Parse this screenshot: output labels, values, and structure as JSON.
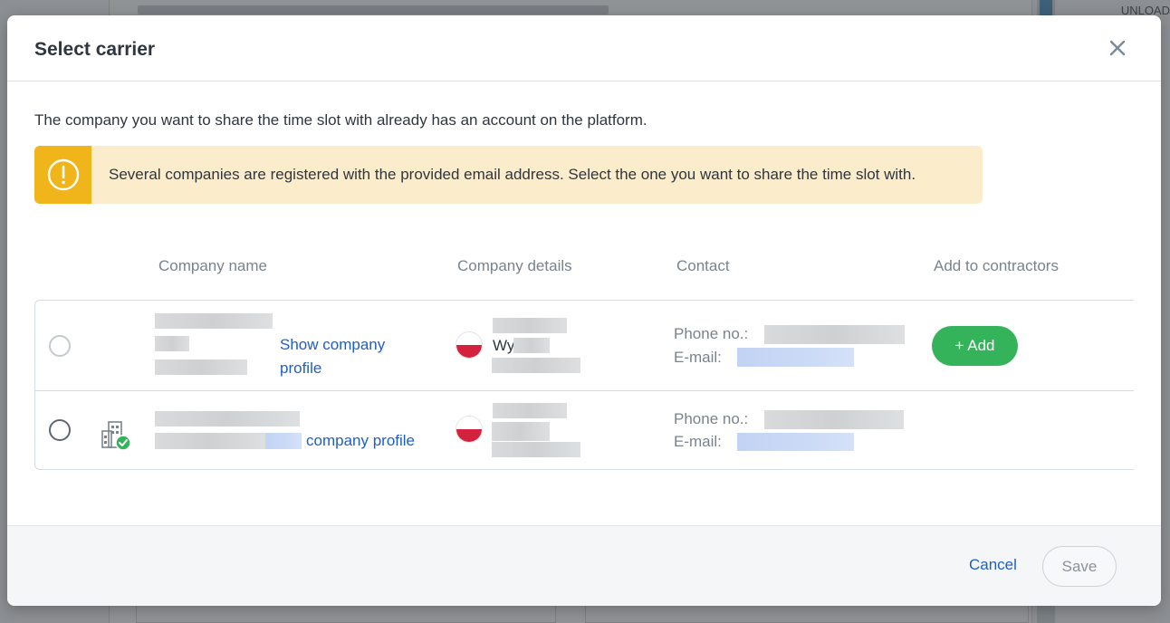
{
  "background": {
    "unload_label": "UNLOAD"
  },
  "modal": {
    "title": "Select carrier",
    "intro": "The company you want to share the time slot with already has an account on the platform.",
    "alert": {
      "text": "Several companies are registered with the provided email address. Select the one you want to share the time slot with.",
      "icon": "exclamation-circle-icon"
    },
    "columns": [
      "Company name",
      "Company details",
      "Contact",
      "Add to contractors"
    ],
    "rows": [
      {
        "selected": false,
        "profile_link": "Show company profile",
        "details_partial": "Wy",
        "flag": "poland-flag-icon",
        "phone_label": "Phone no.:",
        "email_label": "E-mail:",
        "add_label": "+ Add",
        "verified": false
      },
      {
        "selected": false,
        "profile_link": "company profile",
        "flag": "poland-flag-icon",
        "phone_label": "Phone no.:",
        "email_label": "E-mail:",
        "verified": true,
        "verified_icon": "building-verified-icon"
      }
    ],
    "footer": {
      "cancel_label": "Cancel",
      "save_label": "Save"
    }
  },
  "colors": {
    "accent_blue": "#1d5fc7",
    "add_green": "#35b35a",
    "warning_yellow": "#f0b51a",
    "warning_bg": "#fbeccc",
    "scroll_thumb": "#4b86ad"
  }
}
